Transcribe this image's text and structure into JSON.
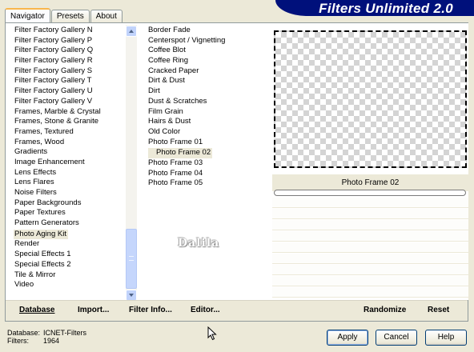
{
  "tabs": [
    {
      "label": "Navigator",
      "active": true
    },
    {
      "label": "Presets",
      "active": false
    },
    {
      "label": "About",
      "active": false
    }
  ],
  "banner": {
    "title": "Filters Unlimited 2.0",
    "color": "#00107b"
  },
  "categories": {
    "items": [
      "Filter Factory Gallery N",
      "Filter Factory Gallery P",
      "Filter Factory Gallery Q",
      "Filter Factory Gallery R",
      "Filter Factory Gallery S",
      "Filter Factory Gallery T",
      "Filter Factory Gallery U",
      "Filter Factory Gallery V",
      "Frames, Marble & Crystal",
      "Frames, Stone & Granite",
      "Frames, Textured",
      "Frames, Wood",
      "Gradients",
      "Image Enhancement",
      "Lens Effects",
      "Lens Flares",
      "Noise Filters",
      "Paper Backgrounds",
      "Paper Textures",
      "Pattern Generators",
      "Photo Aging Kit",
      "Render",
      "Special Effects 1",
      "Special Effects 2",
      "Tile & Mirror",
      "Video"
    ],
    "selected": "Photo Aging Kit"
  },
  "filters": {
    "items": [
      "Border Fade",
      "Centerspot / Vignetting",
      "Coffee Blot",
      "Coffee Ring",
      "Cracked Paper",
      "Dirt & Dust",
      "Dirt",
      "Dust & Scratches",
      "Film Grain",
      "Hairs & Dust",
      "Old Color",
      "Photo Frame 01",
      "Photo Frame 02",
      "Photo Frame 03",
      "Photo Frame 04",
      "Photo Frame 05"
    ],
    "selected": "Photo Frame 02"
  },
  "preview": {
    "filter_name": "Photo Frame 02"
  },
  "watermark": "Dalila",
  "bottom_bar": {
    "database": "Database",
    "import": "Import...",
    "filter_info": "Filter Info...",
    "editor": "Editor...",
    "randomize": "Randomize",
    "reset": "Reset"
  },
  "status": {
    "database_label": "Database:",
    "database_value": "ICNET-Filters",
    "filters_label": "Filters:",
    "filters_value": "1964"
  },
  "buttons": {
    "apply": "Apply",
    "cancel": "Cancel",
    "help": "Help"
  }
}
